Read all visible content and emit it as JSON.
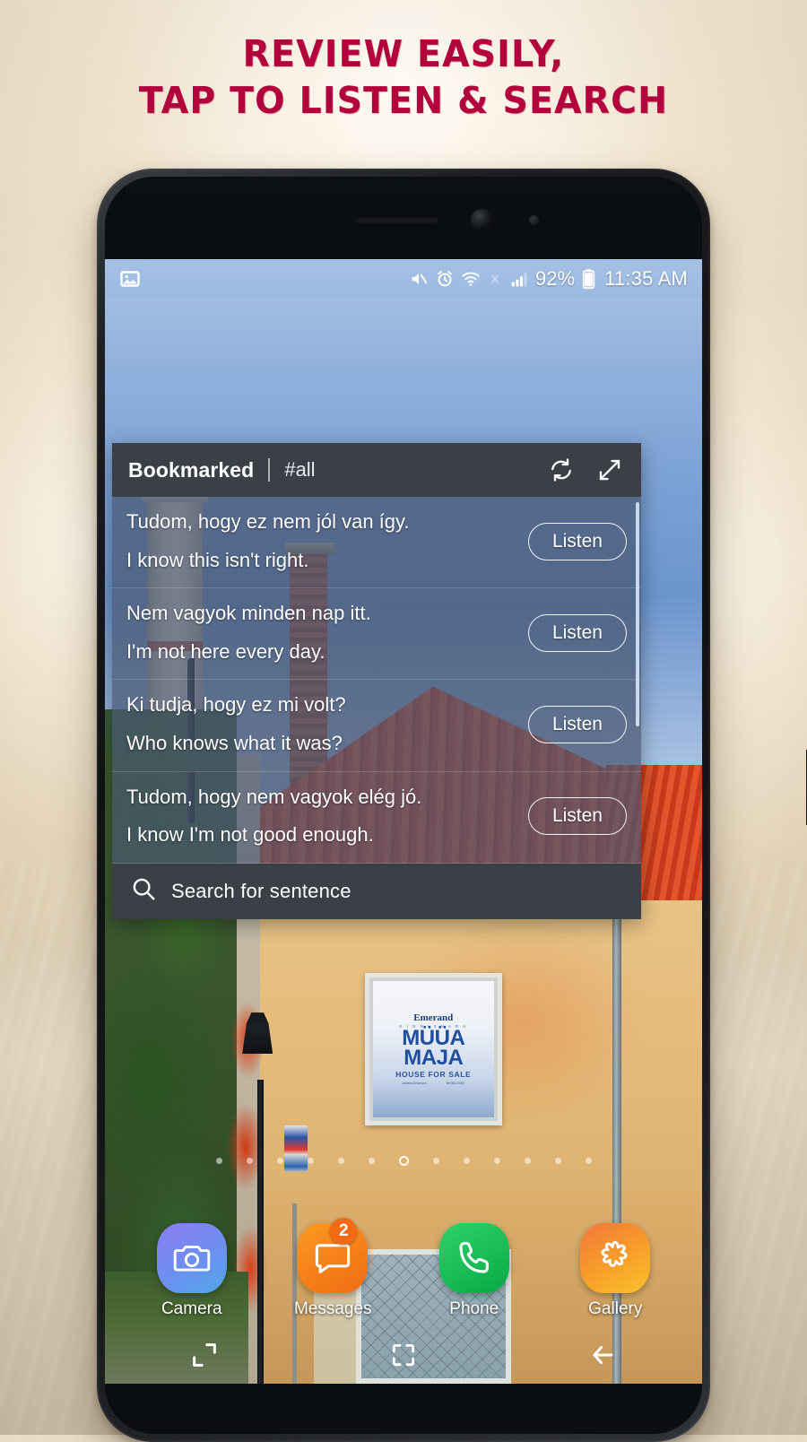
{
  "promo": {
    "headline_line1": "REVIEW EASILY,",
    "headline_line2": "TAP TO LISTEN & SEARCH",
    "headline_color": "#b2013c"
  },
  "statusbar": {
    "left_icons": [
      "image-icon"
    ],
    "right_icons": [
      "mute-icon",
      "alarm-icon",
      "wifi-icon",
      "bluetooth-off-icon",
      "signal-icon"
    ],
    "battery_percent": "92%",
    "time": "11:35 AM"
  },
  "overlay": {
    "title": "Bookmarked",
    "tag": "#all",
    "refresh_icon": "refresh-icon",
    "expand_icon": "expand-icon",
    "rows": [
      {
        "source": "Tudom, hogy ez nem jól van így.",
        "target": "I know this isn't right.",
        "button": "Listen"
      },
      {
        "source": "Nem vagyok minden nap itt.",
        "target": "I'm not here every day.",
        "button": "Listen"
      },
      {
        "source": "Ki tudja, hogy ez mi volt?",
        "target": "Who knows what it was?",
        "button": "Listen"
      },
      {
        "source": "Tudom, hogy nem vagyok elég jó.",
        "target": "I know I'm not good enough.",
        "button": "Listen"
      }
    ],
    "search": {
      "icon": "search-icon",
      "placeholder": "Search for sentence"
    }
  },
  "wallpaper": {
    "sign_brand": "Emerand",
    "sign_brand_sub": "K I N N I S V A R A",
    "sign_line1": "MÜÜA",
    "sign_line2": "MAJA",
    "sign_footer": "HOUSE FOR SALE",
    "sign_contact_left": "Andrus Emerson",
    "sign_contact_right": "Tel 661 2067"
  },
  "homescreen": {
    "page_dots": {
      "count": 13,
      "active_index": 6
    },
    "dock": [
      {
        "label": "Camera",
        "icon": "camera-icon",
        "color": "#6f8ef2",
        "badge": null
      },
      {
        "label": "Messages",
        "icon": "messages-icon",
        "color": "#f57f18",
        "badge": "2"
      },
      {
        "label": "Phone",
        "icon": "phone-icon",
        "color": "#18bd56",
        "badge": null
      },
      {
        "label": "Gallery",
        "icon": "gallery-icon",
        "color": "#f79a2a",
        "badge": null
      }
    ],
    "navbar": [
      {
        "name": "recents-button"
      },
      {
        "name": "home-button"
      },
      {
        "name": "back-button"
      }
    ]
  }
}
